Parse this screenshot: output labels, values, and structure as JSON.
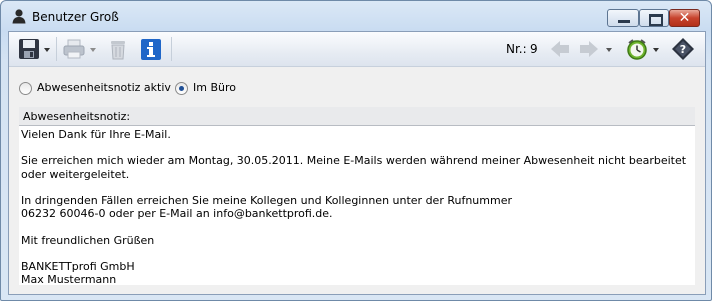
{
  "window": {
    "title": "Benutzer Groß",
    "close_glyph": "✕"
  },
  "toolbar": {
    "icons": [
      "save-icon",
      "print-icon",
      "trash-icon",
      "info-icon",
      "back-arrow-icon",
      "forward-arrow-icon",
      "alarm-clock-icon",
      "help-icon"
    ],
    "nr_label": "Nr.:",
    "nr_value": "9"
  },
  "status": {
    "option_absent": "Abwesenheitsnotiz aktiv",
    "option_office": "Im Büro",
    "selected": "Im Büro"
  },
  "memo": {
    "label": "Abwesenheitsnotiz:",
    "text": "Vielen Dank für Ihre E-Mail.\n\nSie erreichen mich wieder am Montag, 30.05.2011. Meine E-Mails werden während meiner Abwesenheit nicht bearbeitet oder weitergeleitet.\n\nIn dringenden Fällen erreichen Sie meine Kollegen und Kolleginnen unter der Rufnummer\n06232 60046-0 oder per E-Mail an info@bankettprofi.de.\n\nMit freundlichen Grüßen\n\nBANKETTprofi GmbH\nMax Mustermann"
  },
  "colors": {
    "title_bar": "#d4e3f3",
    "close_button": "#c7432d",
    "info_blue": "#1f66c8",
    "clock_green": "#6eb42c"
  }
}
